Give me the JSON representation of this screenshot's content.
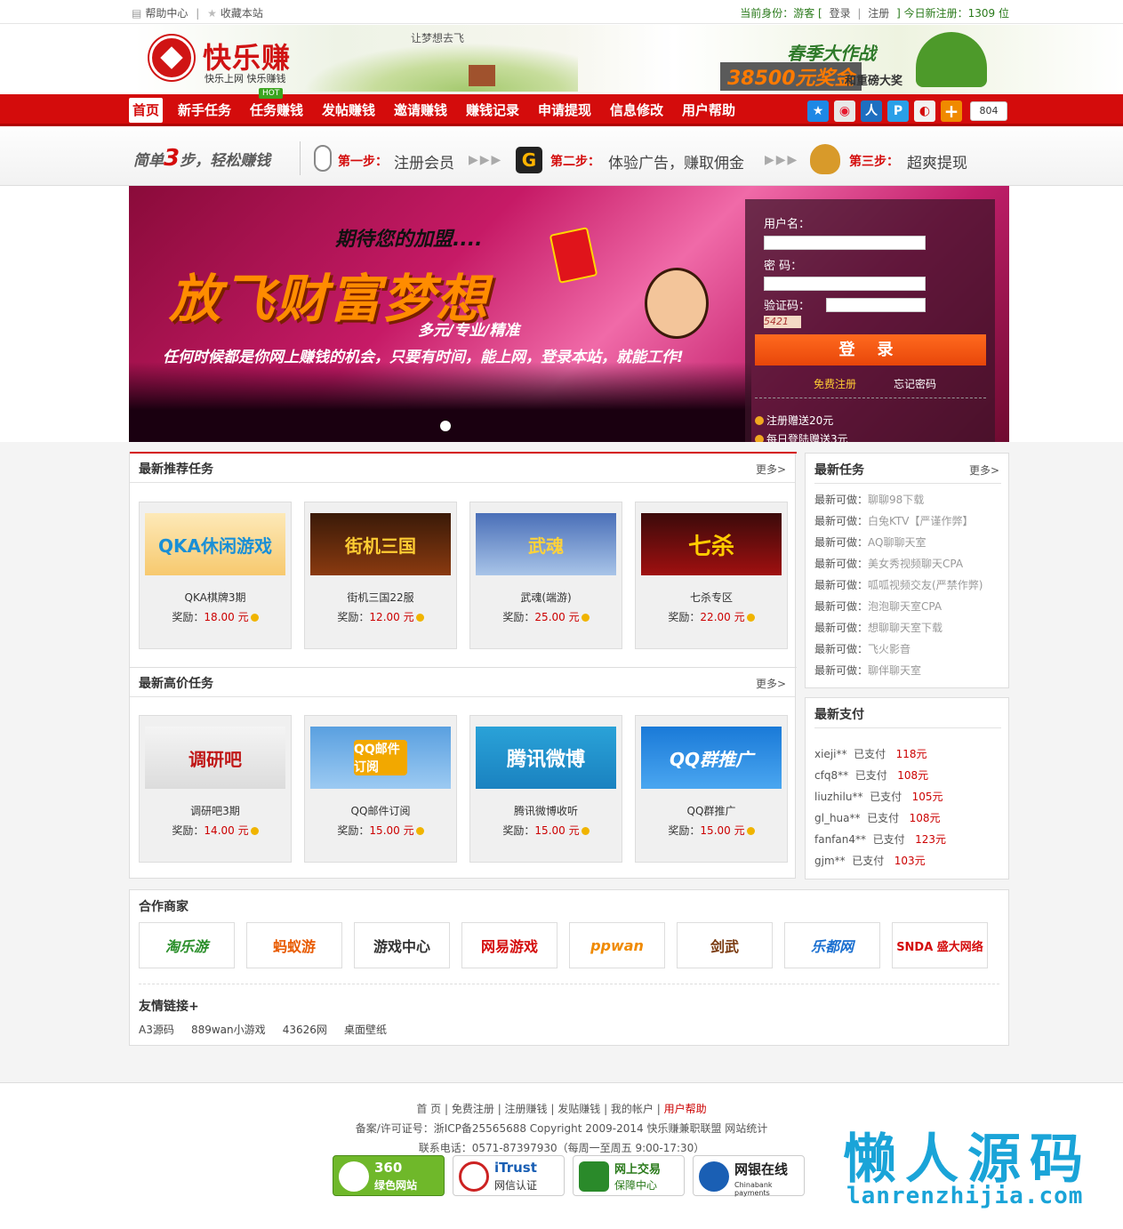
{
  "topbar": {
    "help": "帮助中心",
    "sep": "|",
    "favorite": "收藏本站",
    "identity_label": "当前身份：游客 [",
    "login": "登录",
    "sep2": "|",
    "register": "注册",
    "close": "]",
    "new_reg": "今日新注册：1309 位"
  },
  "header": {
    "logo": "快乐赚",
    "logo_sub": "快乐上网  快乐赚钱",
    "slogan": "让梦想去飞",
    "promo_title": "春季大作战",
    "promo_money": "38500元奖金",
    "promo_sub": "和重磅大奖"
  },
  "nav": {
    "items": [
      "首页",
      "新手任务",
      "任务赚钱",
      "发帖赚钱",
      "邀请赚钱",
      "赚钱记录",
      "申请提现",
      "信息修改",
      "用户帮助"
    ],
    "hot": "HOT",
    "share_count": "804"
  },
  "steps": {
    "intro_a": "简单",
    "intro_num": "3",
    "intro_b": "步，轻松赚钱",
    "step1_label": "第一步：",
    "step1_text": "注册会员",
    "step2_label": "第二步：",
    "step2_text": "体验广告，赚取佣金",
    "step3_label": "第三步：",
    "step3_text": "超爽提现",
    "arrow": "▶▶▶",
    "g_icon": "G"
  },
  "banner": {
    "line1": "期待您的加盟....",
    "line2": "放飞财富梦想",
    "line3": "多元/专业/精准",
    "line4": "任何时候都是你网上赚钱的机会，只要有时间，能上网，登录本站，就能工作!"
  },
  "login": {
    "username_label": "用户名：",
    "password_label": "密  码：",
    "captcha_label": "验证码：",
    "captcha_code": "5421",
    "button": "登 录",
    "register": "免费注册",
    "forgot": "忘记密码",
    "gift1": "注册赠送20元",
    "gift2": "每日登陆赠送3元"
  },
  "recommend": {
    "title": "最新推荐任务",
    "more": "更多>",
    "cards": [
      {
        "img": "QKA休闲游戏",
        "name": "QKA棋牌3期",
        "reward_label": "奖励：",
        "reward": "18.00 元"
      },
      {
        "img": "街机三国",
        "name": "街机三国22服",
        "reward_label": "奖励：",
        "reward": "12.00 元"
      },
      {
        "img": "武魂",
        "name": "武魂(端游)",
        "reward_label": "奖励：",
        "reward": "25.00 元"
      },
      {
        "img": "七杀",
        "name": "七杀专区",
        "reward_label": "奖励：",
        "reward": "22.00 元"
      }
    ]
  },
  "highprice": {
    "title": "最新高价任务",
    "more": "更多>",
    "cards": [
      {
        "img": "调研吧",
        "name": "调研吧3期",
        "reward_label": "奖励：",
        "reward": "14.00 元"
      },
      {
        "img": "QQ邮件订阅",
        "name": "QQ邮件订阅",
        "reward_label": "奖励：",
        "reward": "15.00 元"
      },
      {
        "img": "腾讯微博",
        "name": "腾讯微博收听",
        "reward_label": "奖励：",
        "reward": "15.00 元"
      },
      {
        "img": "QQ群推广",
        "name": "QQ群推广",
        "reward_label": "奖励：",
        "reward": "15.00 元"
      }
    ]
  },
  "latest_tasks": {
    "title": "最新任务",
    "more": "更多>",
    "prefix": "最新可做：",
    "items": [
      "聊聊98下载",
      "白兔KTV【严谨作弊】",
      "AQ聊聊天室",
      "美女秀视频聊天CPA",
      "呱呱视频交友(严禁作弊)",
      "泡泡聊天室CPA",
      "想聊聊天室下载",
      "飞火影音",
      "聊伴聊天室"
    ]
  },
  "latest_pay": {
    "title": "最新支付",
    "paid": "已支付",
    "items": [
      {
        "user": "xieji**",
        "amount": "118元"
      },
      {
        "user": "cfq8**",
        "amount": "108元"
      },
      {
        "user": "liuzhilu**",
        "amount": "105元"
      },
      {
        "user": "gl_hua**",
        "amount": "108元"
      },
      {
        "user": "fanfan4**",
        "amount": "123元"
      },
      {
        "user": "gjm**",
        "amount": "103元"
      }
    ]
  },
  "partners": {
    "title": "合作商家",
    "logos": [
      "淘乐游",
      "蚂蚁游",
      "游戏中心",
      "网易游戏",
      "ppwan",
      "剑武",
      "乐都网",
      "SNDA 盛大网络"
    ],
    "links_title": "友情链接+",
    "links": [
      "A3源码",
      "889wan小游戏",
      "43626网",
      "桌面壁纸"
    ]
  },
  "footer": {
    "nav": [
      "首 页",
      "免费注册",
      "注册赚钱",
      "发贴赚钱",
      "我的帐户",
      "用户帮助"
    ],
    "icp": "备案/许可证号：浙ICP备25565688   Copyright 2009-2014 快乐赚兼职联盟  网站统计",
    "contact": "联系电话：0571-87397930（每周一至周五 9:00-17:30）",
    "badges": [
      {
        "title": "360",
        "sub": "绿色网站"
      },
      {
        "title": "iTrust",
        "sub": "网信认证"
      },
      {
        "title": "网上交易",
        "sub": "保障中心"
      },
      {
        "title": "网银在线",
        "sub": "Chinabank payments"
      }
    ]
  },
  "watermark": {
    "cn": "懒人源码",
    "en": "lanrenzhijia.com"
  },
  "colors": {
    "brand_red": "#d40c0c",
    "reward_red": "#cc0000",
    "green": "#2a7a1b"
  }
}
